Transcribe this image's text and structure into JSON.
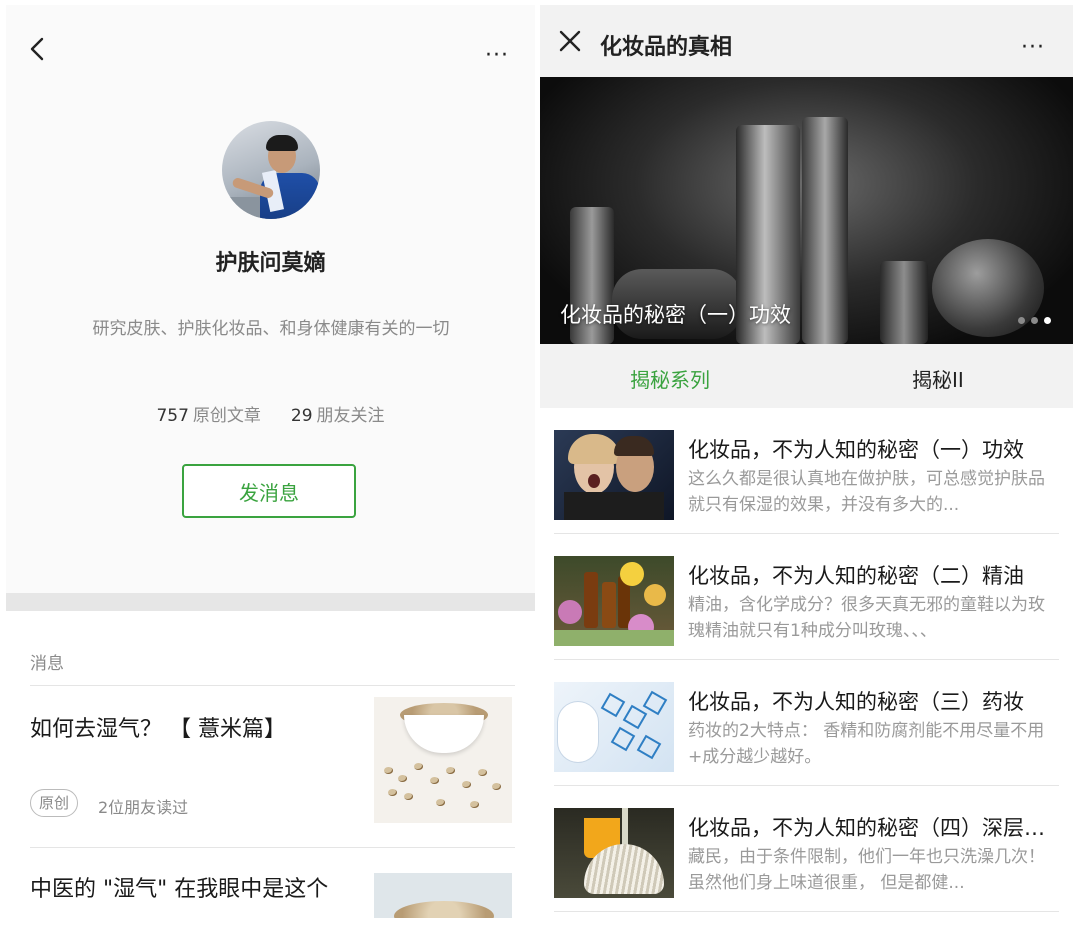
{
  "left": {
    "header": {
      "back_icon": "chevron-left-icon",
      "more_icon": "more-dots-icon",
      "more_label": "···"
    },
    "profile": {
      "name": "护肤问莫嫡",
      "description": "研究皮肤、护肤化妆品、和身体健康有关的一切",
      "articles_count": "757",
      "articles_label": "原创文章",
      "friends_count": "29",
      "friends_label": "朋友关注",
      "message_button": "发消息"
    },
    "messages": {
      "section_title": "消息",
      "items": [
        {
          "title": "如何去湿气？ 【 薏米篇】",
          "tag": "原创",
          "readers": "2位朋友读过"
        },
        {
          "title": "中医的 \"湿气\" 在我眼中是这个"
        }
      ]
    }
  },
  "right": {
    "header": {
      "title": "化妆品的真相",
      "close_icon": "close-icon",
      "more_icon": "more-dots-icon",
      "more_label": "···"
    },
    "banner": {
      "caption": "化妆品的秘密（一）功效",
      "slide_count": 3,
      "active_slide": 3
    },
    "tabs": [
      {
        "label": "揭秘系列",
        "active": true
      },
      {
        "label": "揭秘II",
        "active": false
      }
    ],
    "articles": [
      {
        "title": "化妆品，不为人知的秘密（一）功效",
        "summary": "这么久都是很认真地在做护肤，可总感觉护肤品就只有保湿的效果，并没有多大的...",
        "thumb_icon": "whisper-photo"
      },
      {
        "title": "化妆品，不为人知的秘密（二）精油",
        "summary": "精油，含化学成分？很多天真无邪的童鞋以为玫瑰精油就只有1种成分叫玫瑰、、、",
        "thumb_icon": "essential-oil-photo"
      },
      {
        "title": "化妆品，不为人知的秘密（三）药妆",
        "summary": "药妆的2大特点： 香精和防腐剂能不用尽量不用+成分越少越好。",
        "thumb_icon": "lab-molecule-photo"
      },
      {
        "title": "化妆品，不为人知的秘密（四）深层清洁",
        "summary": "藏民，由于条件限制，他们一年也只洗澡几次！ 虽然他们身上味道很重， 但是都健...",
        "thumb_icon": "mop-bucket-photo"
      }
    ]
  },
  "colors": {
    "accent_green": "#3aa33f",
    "muted_text": "#8a8a8a",
    "tab_bar_bg": "#f2f2f2"
  }
}
